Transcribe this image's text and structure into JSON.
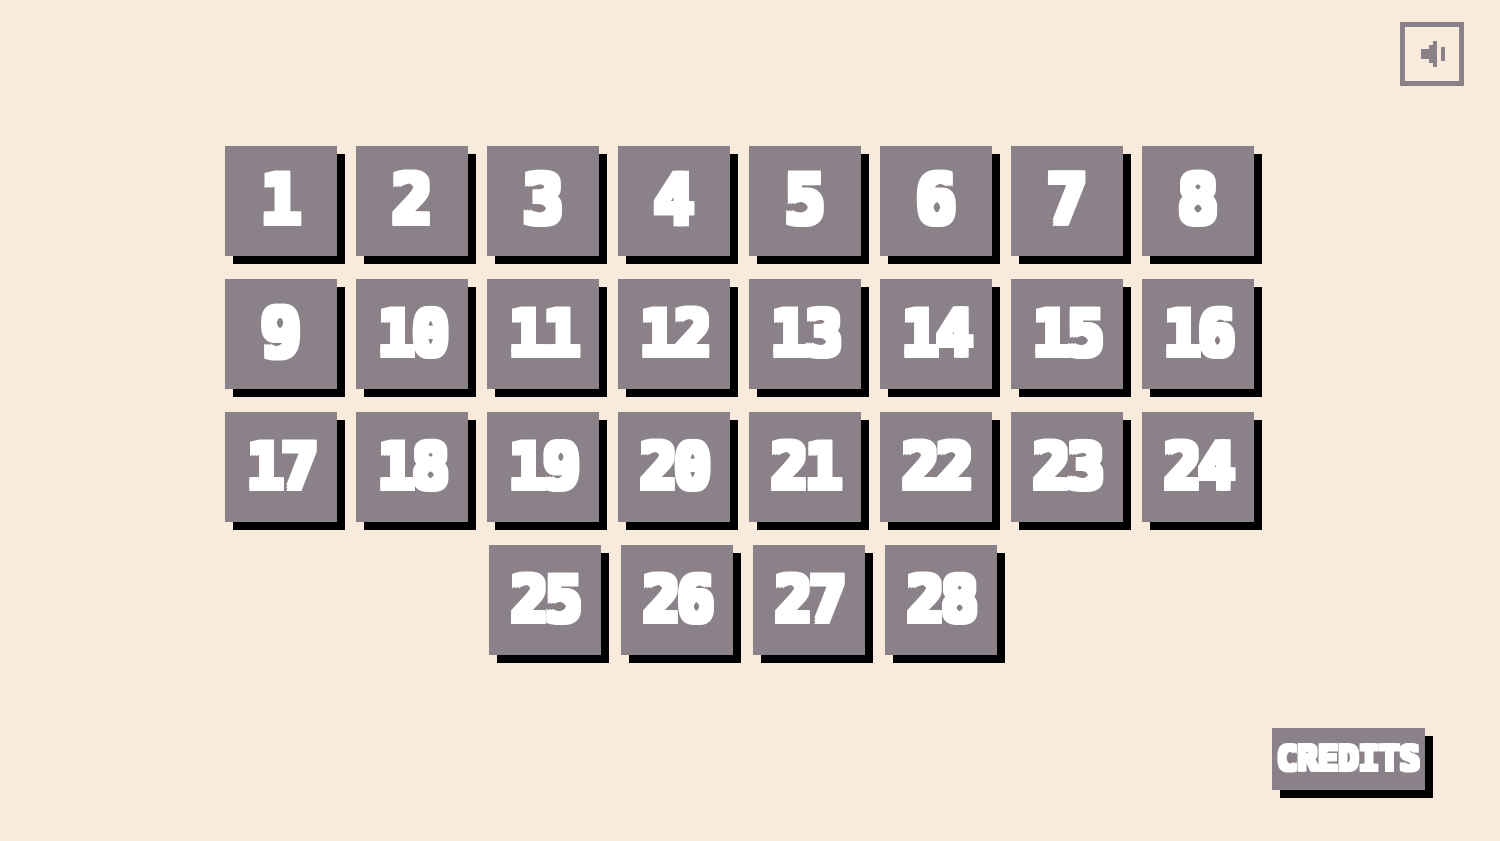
{
  "screen": {
    "background_color": "#f9ebdc",
    "tile_color": "#8a8288",
    "tile_shadow_color": "#000000",
    "text_color": "#ffffff",
    "outline_color": "#8a8288"
  },
  "sound_toggle": {
    "icon": "speaker-on-icon",
    "state": "on"
  },
  "level_select": {
    "rows": [
      {
        "offset": false,
        "levels": [
          "1",
          "2",
          "3",
          "4",
          "5",
          "6",
          "7",
          "8"
        ]
      },
      {
        "offset": false,
        "levels": [
          "9",
          "10",
          "11",
          "12",
          "13",
          "14",
          "15",
          "16"
        ]
      },
      {
        "offset": false,
        "levels": [
          "17",
          "18",
          "19",
          "20",
          "21",
          "22",
          "23",
          "24"
        ]
      },
      {
        "offset": true,
        "levels": [
          "25",
          "26",
          "27",
          "28"
        ]
      }
    ]
  },
  "credits": {
    "label": "CREDITS"
  }
}
